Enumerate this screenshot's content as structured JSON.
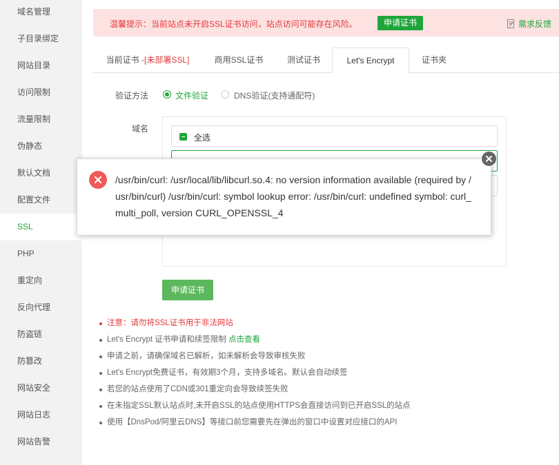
{
  "sidebar": {
    "items": [
      {
        "label": "域名管理",
        "active": false
      },
      {
        "label": "子目录绑定",
        "active": false
      },
      {
        "label": "网站目录",
        "active": false
      },
      {
        "label": "访问限制",
        "active": false
      },
      {
        "label": "流量限制",
        "active": false
      },
      {
        "label": "伪静态",
        "active": false
      },
      {
        "label": "默认文档",
        "active": false
      },
      {
        "label": "配置文件",
        "active": false
      },
      {
        "label": "SSL",
        "active": true
      },
      {
        "label": "PHP",
        "active": false
      },
      {
        "label": "重定向",
        "active": false
      },
      {
        "label": "反向代理",
        "active": false
      },
      {
        "label": "防盗链",
        "active": false
      },
      {
        "label": "防篡改",
        "active": false
      },
      {
        "label": "网站安全",
        "active": false
      },
      {
        "label": "网站日志",
        "active": false
      },
      {
        "label": "网站告警",
        "active": false
      }
    ]
  },
  "banner": {
    "text": "温馨提示：当前站点未开启SSL证书访问，站点访问可能存在风险。",
    "button": "申请证书",
    "feedback": "需求反馈",
    "feedback_icon": "edit-icon"
  },
  "tabs": {
    "current_prefix": "当前证书 -",
    "current_status": "[未部署SSL]",
    "commercial": "商用SSL证书",
    "test": "测试证书",
    "letsencrypt": "Let's Encrypt",
    "folder": "证书夹",
    "active": "letsencrypt"
  },
  "form": {
    "verify_label": "验证方法",
    "option_file": "文件验证",
    "option_dns": "DNS验证(支持通配符)",
    "domain_label": "域名",
    "select_all": "全选",
    "apply_button": "申请证书"
  },
  "notes": {
    "n1": "注意：请勿将SSL证书用于非法网站",
    "n2_text": "Let's Encrypt 证书申请和续签限制 ",
    "n2_link": "点击查看",
    "n3": "申请之前，请确保域名已解析，如未解析会导致审核失败",
    "n4": "Let's Encrypt免费证书，有效期3个月，支持多域名。默认会自动续签",
    "n5": "若您的站点使用了CDN或301重定向会导致续签失败",
    "n6": "在未指定SSL默认站点时,未开启SSL的站点使用HTTPS会直接访问到已开启SSL的站点",
    "n7": "使用【DnsPod/阿里云DNS】等接口前您需要先在弹出的窗口中设置对应接口的API"
  },
  "popup": {
    "message": "/usr/bin/curl: /usr/local/lib/libcurl.so.4: no version information available (required by /usr/bin/curl) /usr/bin/curl: symbol lookup error: /usr/bin/curl: undefined symbol: curl_multi_poll, version CURL_OPENSSL_4",
    "icon": "error-icon",
    "close_icon": "close-icon"
  },
  "colors": {
    "accent": "#20a53a",
    "danger": "#e4393c",
    "banner_bg": "#fde2e2",
    "error_icon": "#ef5a5a"
  }
}
